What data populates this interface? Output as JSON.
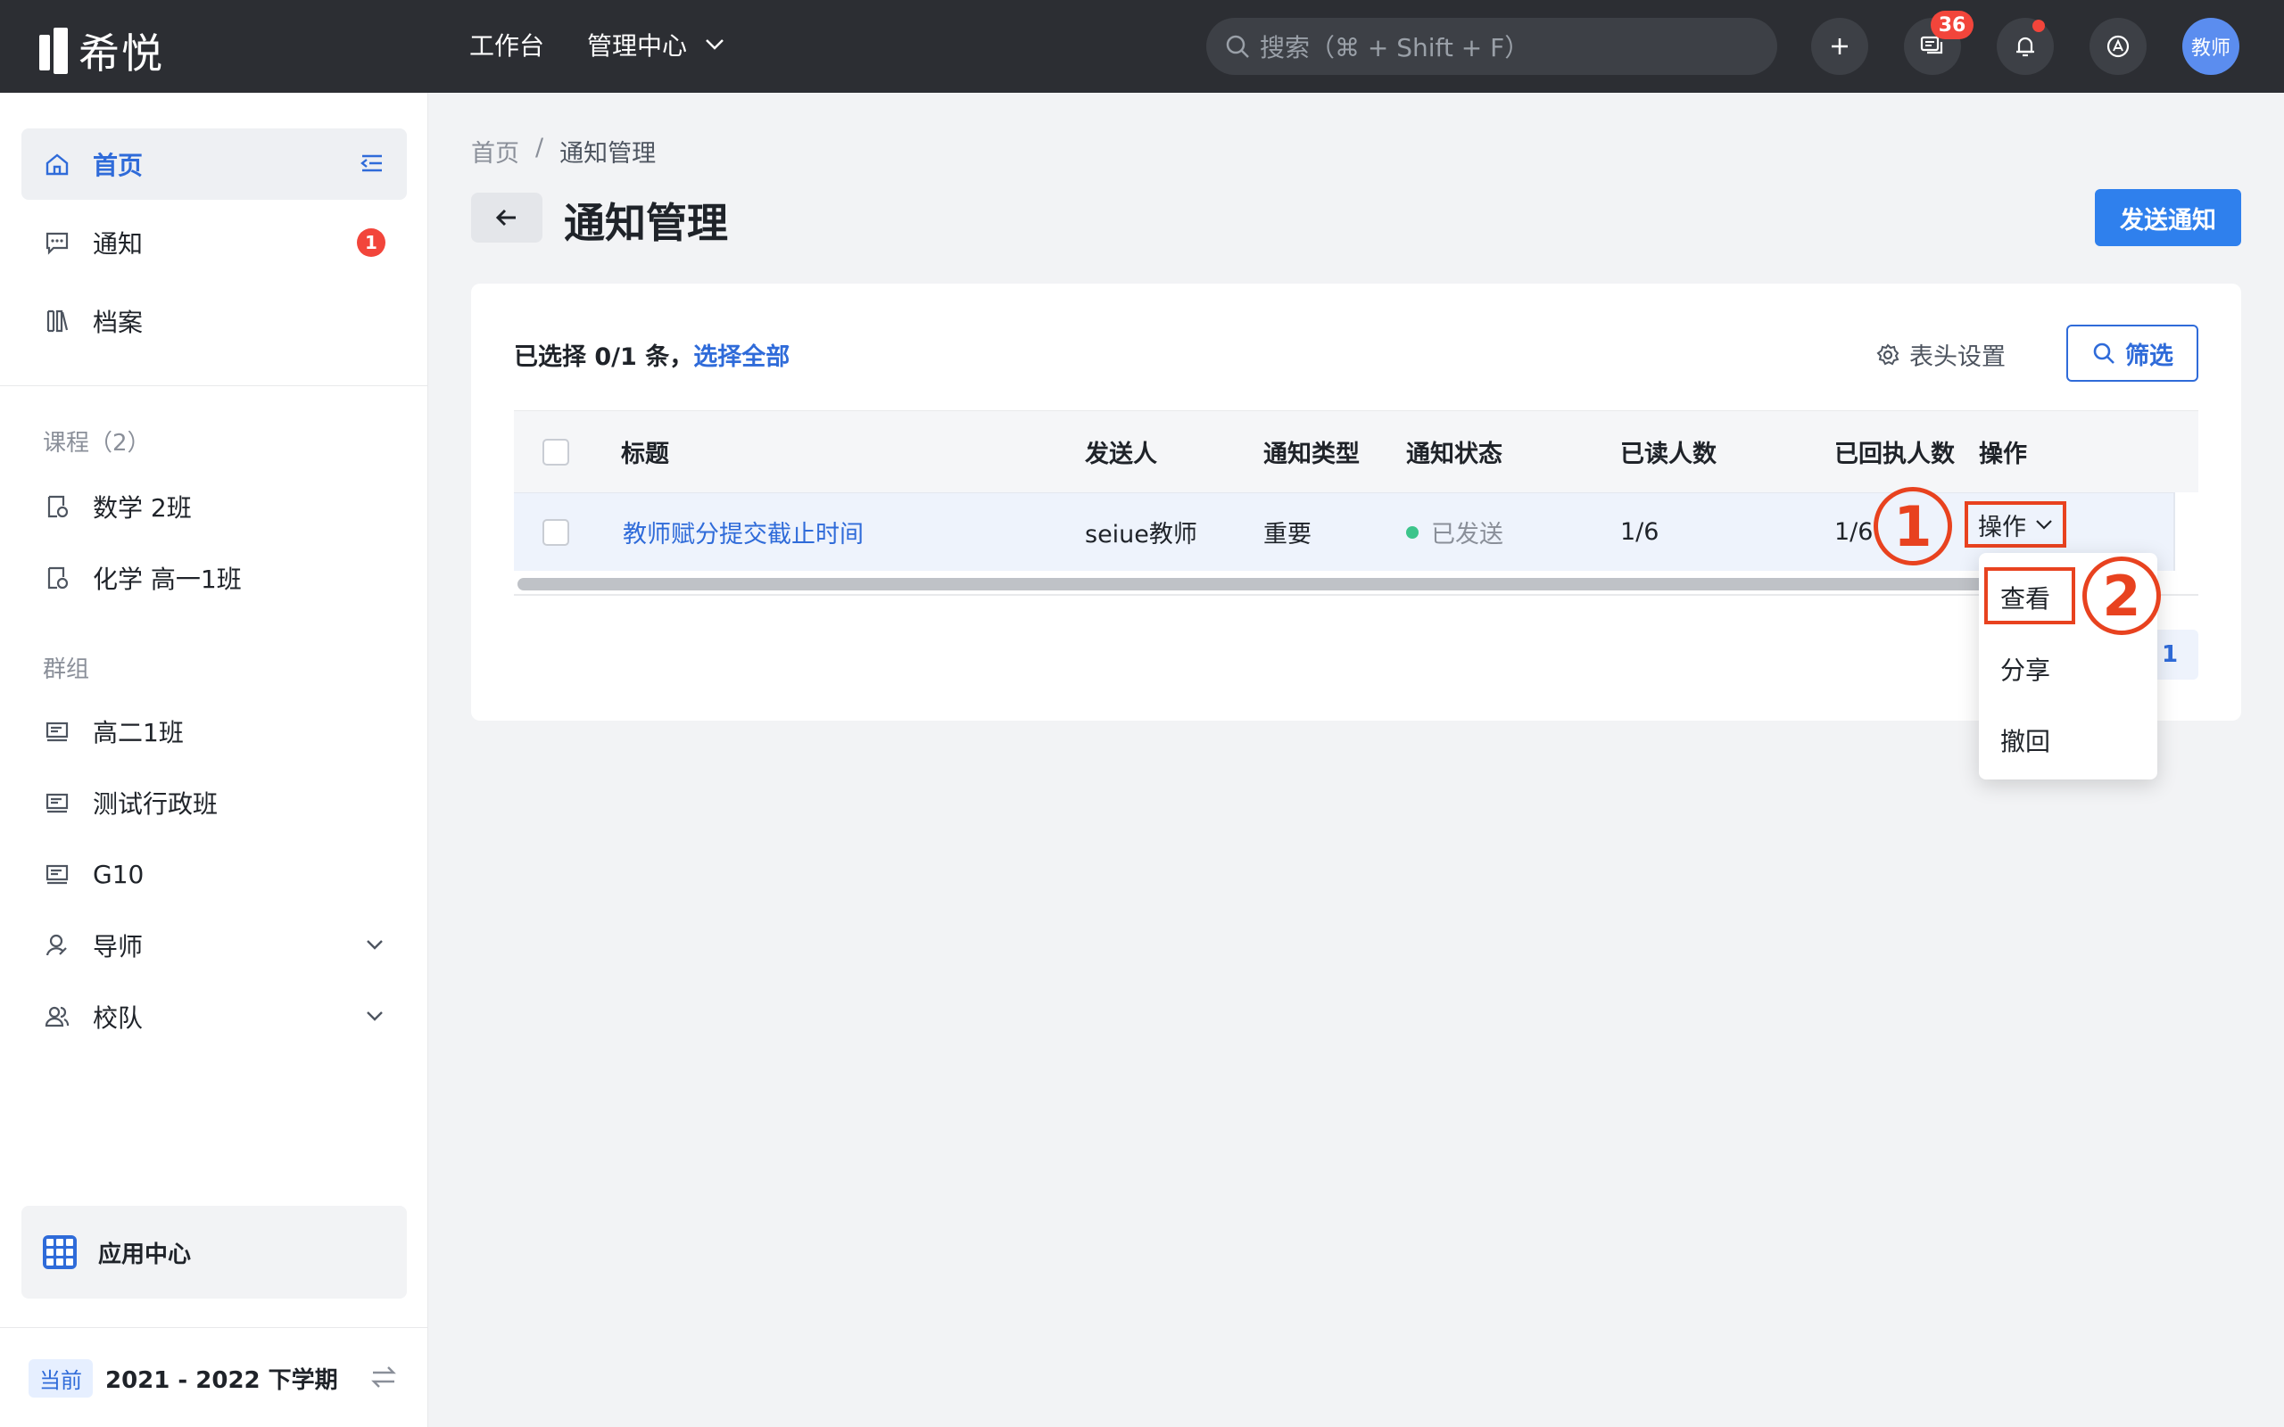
{
  "topbar": {
    "logo_text": "希悦",
    "nav": {
      "workbench": "工作台",
      "manage": "管理中心"
    },
    "search_placeholder": "搜索（⌘ + Shift + F）",
    "message_count": "36",
    "avatar_text": "教师"
  },
  "sidebar": {
    "home": "首页",
    "notice": "通知",
    "notice_badge": "1",
    "archive": "档案",
    "courses_title": "课程（2）",
    "courses": [
      "数学 2班",
      "化学 高一1班"
    ],
    "groups_title": "群组",
    "groups": [
      "高二1班",
      "测试行政班",
      "G10",
      "导师",
      "校队"
    ],
    "app_center": "应用中心",
    "term_tag": "当前",
    "term": "2021 - 2022 下学期"
  },
  "main": {
    "breadcrumb": [
      "首页",
      "/",
      "通知管理"
    ],
    "title": "通知管理",
    "send_button": "发送通知",
    "selection_text": "已选择 0/1 条，",
    "select_all": "选择全部",
    "column_settings": "表头设置",
    "filter_button": "筛选",
    "table": {
      "headers": [
        "标题",
        "发送人",
        "通知类型",
        "通知状态",
        "已读人数",
        "已回执人数",
        "操作"
      ],
      "rows": [
        {
          "title": "教师赋分提交截止时间",
          "sender": "seiue教师",
          "type": "重要",
          "status": "已发送",
          "read": "1/6",
          "receipt": "1/6",
          "action": "操作"
        }
      ]
    },
    "page_number": "1",
    "dropdown": [
      "查看",
      "分享",
      "撤回"
    ],
    "step_labels": [
      "1",
      "2"
    ],
    "colors": {
      "accent": "#2f6bd9",
      "primary_button": "#2f80ed",
      "annotation": "#e8421f",
      "status_sent": "#3cc48b"
    }
  }
}
